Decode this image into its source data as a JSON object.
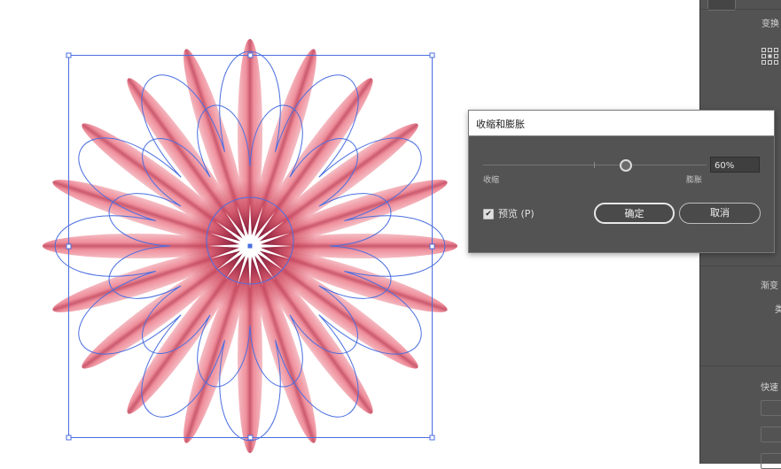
{
  "dialog": {
    "title": "收缩和膨胀",
    "slider_left_label": "收缩",
    "slider_right_label": "膨胀",
    "value": "60%",
    "slider_fraction": 0.6,
    "preview_label": "预览",
    "preview_shortcut": "(P)",
    "preview_checked": true,
    "ok_label": "确定",
    "cancel_label": "取消"
  },
  "panel": {
    "transform_title": "变换",
    "gradient_title": "渐变",
    "gradient_type_fragment": "类",
    "quick_actions_fragment": "快速"
  },
  "colors": {
    "panel_bg": "#535353",
    "path_stroke": "#4a6ee0",
    "petal_core": "#c8445a",
    "petal_edge": "#f08c9a"
  },
  "icons": [
    "reference-point-icon",
    "checkbox-check-icon",
    "slider-thumb-icon"
  ]
}
